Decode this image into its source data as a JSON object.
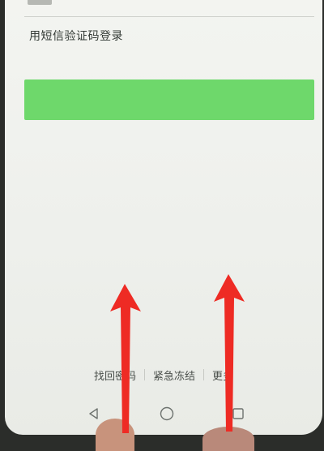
{
  "login": {
    "sms_login_link": "用短信验证码登录",
    "login_button_label": ""
  },
  "footer": {
    "links": [
      "找回密码",
      "紧急冻结",
      "更多"
    ]
  },
  "navbar": {
    "back_icon": "triangle-back-icon",
    "home_icon": "circle-home-icon",
    "recent_icon": "square-recents-icon"
  },
  "colors": {
    "accent_green": "#6ed86b",
    "annotation_arrow": "#ee2b24",
    "background": "#f3f4f0"
  }
}
